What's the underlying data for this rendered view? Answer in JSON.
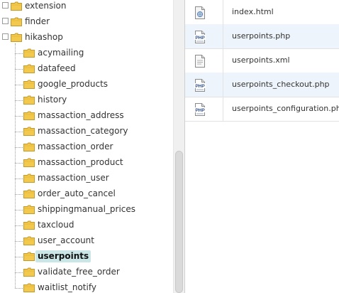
{
  "tree": {
    "items": [
      {
        "label": "extension",
        "level": 0,
        "expander": "+",
        "selected": false
      },
      {
        "label": "finder",
        "level": 0,
        "expander": "+",
        "selected": false
      },
      {
        "label": "hikashop",
        "level": 0,
        "expander": "−",
        "selected": false
      },
      {
        "label": "acymailing",
        "level": 1,
        "selected": false
      },
      {
        "label": "datafeed",
        "level": 1,
        "selected": false
      },
      {
        "label": "google_products",
        "level": 1,
        "selected": false
      },
      {
        "label": "history",
        "level": 1,
        "selected": false
      },
      {
        "label": "massaction_address",
        "level": 1,
        "selected": false
      },
      {
        "label": "massaction_category",
        "level": 1,
        "selected": false
      },
      {
        "label": "massaction_order",
        "level": 1,
        "selected": false
      },
      {
        "label": "massaction_product",
        "level": 1,
        "selected": false
      },
      {
        "label": "massaction_user",
        "level": 1,
        "selected": false
      },
      {
        "label": "order_auto_cancel",
        "level": 1,
        "selected": false
      },
      {
        "label": "shippingmanual_prices",
        "level": 1,
        "selected": false
      },
      {
        "label": "taxcloud",
        "level": 1,
        "selected": false
      },
      {
        "label": "user_account",
        "level": 1,
        "selected": false
      },
      {
        "label": "userpoints",
        "level": 1,
        "selected": true
      },
      {
        "label": "validate_free_order",
        "level": 1,
        "selected": false
      },
      {
        "label": "waitlist_notify",
        "level": 1,
        "selected": false
      }
    ]
  },
  "files": [
    {
      "name": "index.html",
      "icon": "html-file-icon"
    },
    {
      "name": "userpoints.php",
      "icon": "php-file-icon"
    },
    {
      "name": "userpoints.xml",
      "icon": "xml-file-icon"
    },
    {
      "name": "userpoints_checkout.php",
      "icon": "php-file-icon"
    },
    {
      "name": "userpoints_configuration.php",
      "icon": "php-file-icon"
    }
  ],
  "colors": {
    "folder": "#f2c94c",
    "selection": "#cbe6e6",
    "alt_row": "#eef4fb",
    "php_icon": "#2f4f8f"
  }
}
